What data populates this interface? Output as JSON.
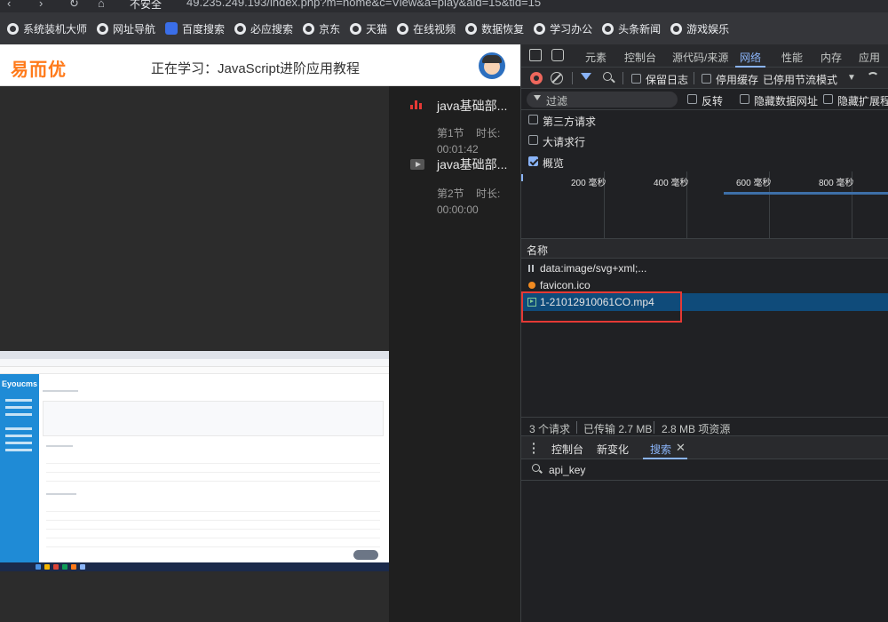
{
  "browser": {
    "secure_label": "不安全",
    "url": "49.235.249.193/index.php?m=home&c=View&a=play&aid=15&tid=15"
  },
  "bookmarks": [
    {
      "label": "系统装机大师",
      "icon": "globe-icon"
    },
    {
      "label": "网址导航",
      "icon": "globe-icon"
    },
    {
      "label": "百度搜索",
      "icon": "baidu-icon"
    },
    {
      "label": "必应搜索",
      "icon": "globe-icon"
    },
    {
      "label": "京东",
      "icon": "globe-icon"
    },
    {
      "label": "天猫",
      "icon": "globe-icon"
    },
    {
      "label": "在线视频",
      "icon": "globe-icon"
    },
    {
      "label": "数据恢复",
      "icon": "globe-icon"
    },
    {
      "label": "学习办公",
      "icon": "globe-icon"
    },
    {
      "label": "头条新闻",
      "icon": "globe-icon"
    },
    {
      "label": "游戏娱乐",
      "icon": "globe-icon"
    }
  ],
  "page": {
    "logo": "易而优",
    "course_title": "正在学习：JavaScript进阶应用教程",
    "shot_brand": "Eyoucms",
    "playlist": [
      {
        "name": "java基础部...",
        "section": "第1节",
        "duration_label": "时长:",
        "duration": "00:01:42",
        "playing": true
      },
      {
        "name": "java基础部...",
        "section": "第2节",
        "duration_label": "时长:",
        "duration": "00:00:00",
        "playing": false
      }
    ]
  },
  "devtools": {
    "tabs": [
      "元素",
      "控制台",
      "源代码/来源",
      "网络",
      "性能",
      "内存",
      "应用"
    ],
    "active_tab": "网络",
    "toolbar": {
      "preserve_log": "保留日志",
      "disable_cache": "停用缓存",
      "throttling": "已停用节流模式"
    },
    "filter": {
      "placeholder": "过滤",
      "invert": "反转",
      "hide_data_urls": "隐藏数据网址",
      "hide_extension_urls": "隐藏扩展程序网址",
      "third_party": "第三方请求",
      "big_rows": "大请求行",
      "overview": "概览",
      "overview_checked": true
    },
    "timeline_ticks": [
      "200 毫秒",
      "400 毫秒",
      "600 毫秒",
      "800 毫秒"
    ],
    "table_header": "名称",
    "requests": [
      {
        "name": "data:image/svg+xml;...",
        "type": "data",
        "selected": false
      },
      {
        "name": "favicon.ico",
        "type": "favicon",
        "selected": false
      },
      {
        "name": "1-21012910061CO.mp4",
        "type": "media",
        "selected": true
      }
    ],
    "status": {
      "requests": "3 个请求",
      "transferred": "已传输 2.7 MB",
      "resources": "2.8 MB 项资源"
    },
    "drawer": {
      "tabs": [
        "控制台",
        "新变化",
        "搜索"
      ],
      "active": "搜索",
      "search_value": "api_key"
    }
  }
}
